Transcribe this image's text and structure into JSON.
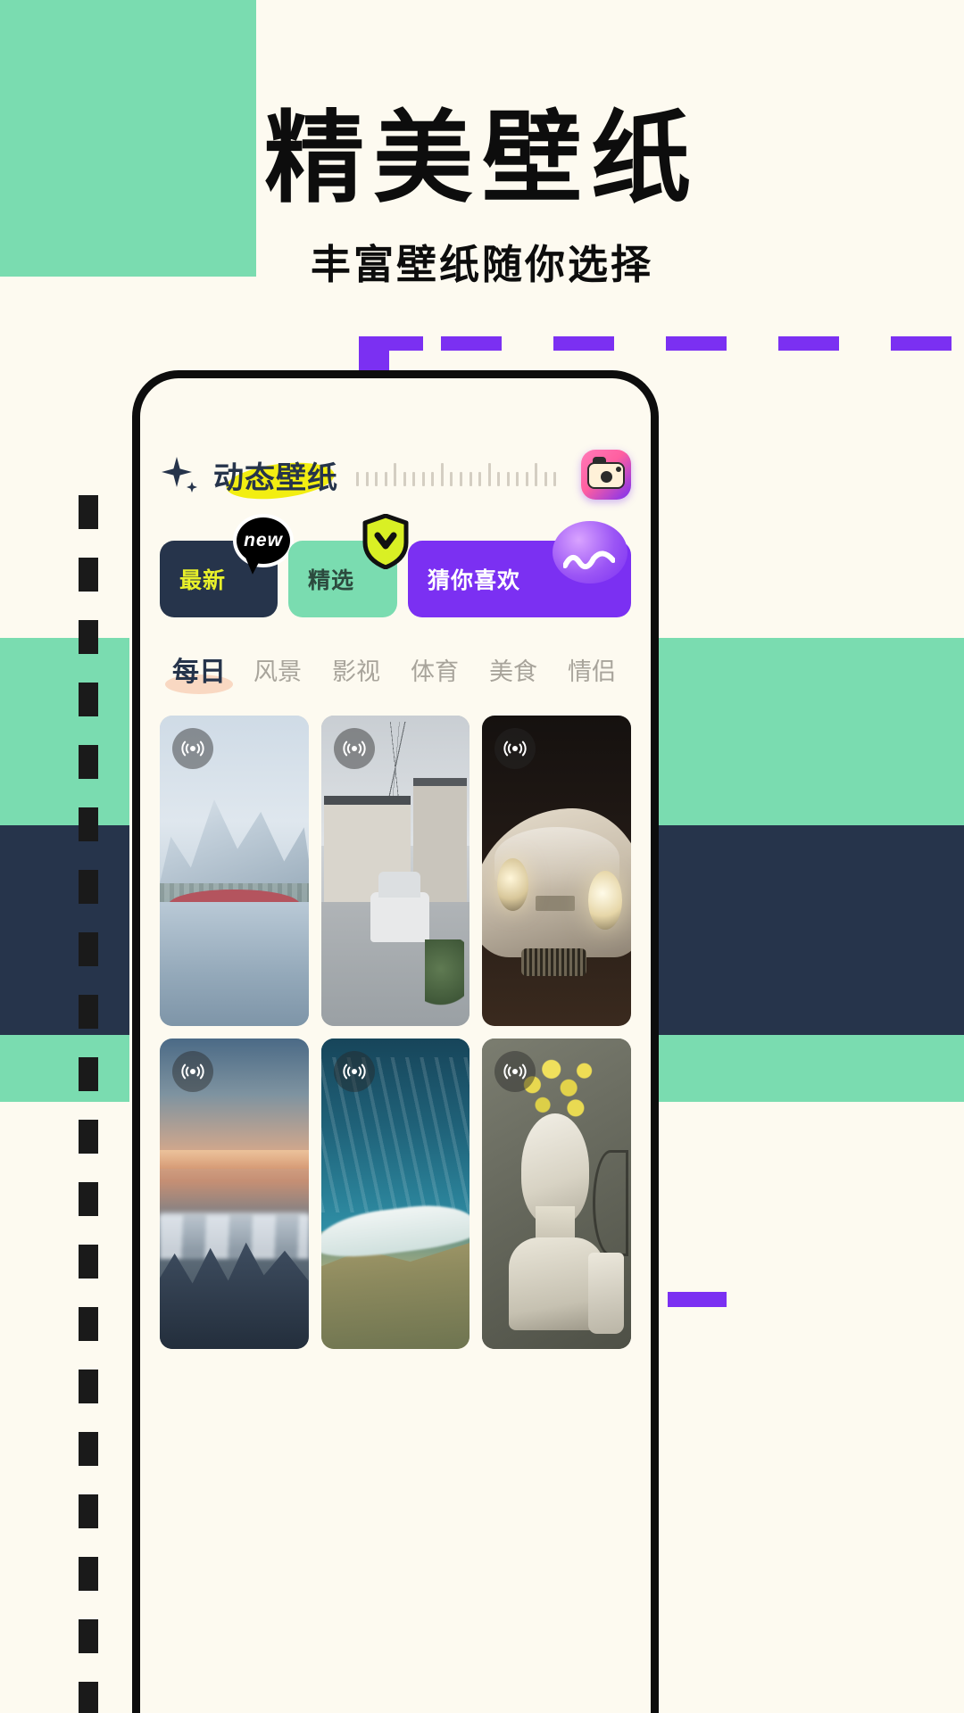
{
  "poster": {
    "title": "精美壁纸",
    "subtitle": "丰富壁纸随你选择",
    "colors": {
      "cream": "#fdfaf0",
      "mint": "#7adcb0",
      "navy": "#26344b",
      "purple": "#7b30f2",
      "yellow": "#f2ee12",
      "peach": "#f9d8c2"
    }
  },
  "app": {
    "header": {
      "sparkle_icon": "sparkle-icon",
      "title": "动态壁纸",
      "highlight_color": "#f2ee12",
      "ruler_icon": "ruler-ticks",
      "camera_icon": "camera-icon"
    },
    "chips": [
      {
        "label": "最新",
        "badge": "new",
        "badge_kind": "speech-bubble",
        "bg": "#26344b",
        "fg": "#e8f02a"
      },
      {
        "label": "精选",
        "badge": "",
        "badge_kind": "shield-check",
        "bg": "#7adcb0",
        "fg": "#2c4a3e"
      },
      {
        "label": "猜你喜欢",
        "badge": "",
        "badge_kind": "gradient-blob",
        "bg": "#7b30f2",
        "fg": "#ffffff"
      }
    ],
    "tabs": [
      {
        "label": "每日",
        "active": true
      },
      {
        "label": "风景",
        "active": false
      },
      {
        "label": "影视",
        "active": false
      },
      {
        "label": "体育",
        "active": false
      },
      {
        "label": "美食",
        "active": false
      },
      {
        "label": "情侣",
        "active": false
      }
    ],
    "wallpapers": [
      {
        "name": "snowy-mountain-bridge",
        "badge_icon": "live-wallpaper-icon",
        "art": "a1"
      },
      {
        "name": "japanese-street-house",
        "badge_icon": "live-wallpaper-icon",
        "art": "a2"
      },
      {
        "name": "classic-car-night",
        "badge_icon": "live-wallpaper-icon",
        "art": "a3"
      },
      {
        "name": "dusk-cloud-peaks",
        "badge_icon": "live-wallpaper-icon",
        "art": "a4"
      },
      {
        "name": "ocean-coastline",
        "badge_icon": "live-wallpaper-icon",
        "art": "a5"
      },
      {
        "name": "statue-mimosa-flowers",
        "badge_icon": "live-wallpaper-icon",
        "art": "a6"
      }
    ]
  }
}
